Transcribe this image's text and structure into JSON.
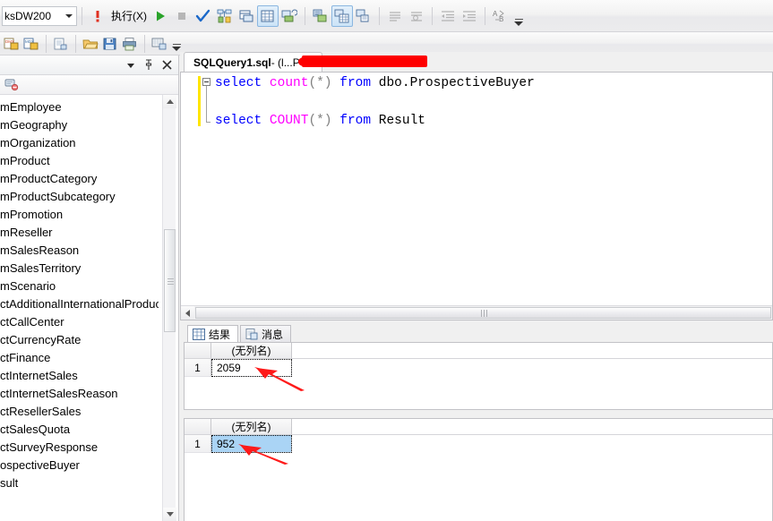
{
  "toolbar_main": {
    "database_combo": {
      "value": "ksDW200",
      "icon": "chevron-down-icon"
    },
    "execute_label": "执行(X)",
    "buttons": [
      {
        "name": "debug-run-button",
        "icon": "exclamation-icon"
      },
      {
        "name": "execute-button",
        "icon": "play-icon"
      },
      {
        "name": "stop-button",
        "icon": "stop-icon"
      },
      {
        "name": "parse-query-button",
        "icon": "check-icon"
      },
      {
        "name": "display-estimated-plan-button",
        "icon": "estimated-plan-icon"
      },
      {
        "name": "query-options-button",
        "icon": "query-options-icon"
      },
      {
        "name": "include-actual-plan-button",
        "icon": "actual-plan-icon"
      },
      {
        "name": "include-client-statistics-button",
        "icon": "client-statistics-icon"
      },
      {
        "name": "results-to-text-button",
        "icon": "results-to-text-icon"
      },
      {
        "name": "results-to-grid-button",
        "icon": "results-to-grid-icon"
      },
      {
        "name": "results-to-file-button",
        "icon": "results-to-file-icon"
      },
      {
        "name": "comment-button",
        "icon": "comment-lines-icon"
      },
      {
        "name": "uncomment-button",
        "icon": "uncomment-lines-icon"
      },
      {
        "name": "decrease-indent-button",
        "icon": "decrease-indent-icon"
      },
      {
        "name": "increase-indent-button",
        "icon": "increase-indent-icon"
      },
      {
        "name": "find-replace-button",
        "icon": "find-replace-icon"
      },
      {
        "name": "toolbar-overflow-button",
        "icon": "overflow-chevron-icon"
      }
    ]
  },
  "toolbar_second": {
    "buttons": [
      {
        "name": "new-dmx-query-button",
        "icon": "dmx-query-icon"
      },
      {
        "name": "new-mdx-query-button",
        "icon": "mdx-query-icon"
      },
      {
        "name": "new-xmla-query-button",
        "icon": "xmla-query-icon"
      },
      {
        "name": "open-file-button",
        "icon": "open-folder-icon"
      },
      {
        "name": "save-button",
        "icon": "save-disk-icon"
      },
      {
        "name": "print-button",
        "icon": "printer-icon"
      },
      {
        "name": "activity-monitor-button",
        "icon": "activity-monitor-icon"
      },
      {
        "name": "toolbar2-overflow-button",
        "icon": "overflow-chevron-icon"
      }
    ]
  },
  "object_explorer": {
    "header_buttons": [
      {
        "name": "window-position-dropdown",
        "icon": "chevron-down-icon"
      },
      {
        "name": "auto-hide-pin-button",
        "icon": "pin-icon"
      },
      {
        "name": "close-panel-button",
        "icon": "close-icon"
      }
    ],
    "toolbar_buttons": [
      {
        "name": "connect-object-explorer-button",
        "icon": "connect-plug-icon"
      }
    ],
    "tree_items": [
      "mEmployee",
      "mGeography",
      "mOrganization",
      "mProduct",
      "mProductCategory",
      "mProductSubcategory",
      "mPromotion",
      "mReseller",
      "mSalesReason",
      "mSalesTerritory",
      "mScenario",
      "ctAdditionalInternationalProduc",
      "ctCallCenter",
      "ctCurrencyRate",
      "ctFinance",
      "ctInternetSales",
      "ctInternetSalesReason",
      "ctResellerSales",
      "ctSalesQuota",
      "ctSurveyResponse",
      "ospectiveBuyer",
      "sult"
    ]
  },
  "editor": {
    "tab_title": "SQLQuery1.sql",
    "tab_subtitle": " - (l...PC\\",
    "lines": [
      {
        "tokens": [
          {
            "text": "select",
            "style": "kw"
          },
          {
            "text": " ",
            "style": "pl"
          },
          {
            "text": "count",
            "style": "fn"
          },
          {
            "text": "(*)",
            "style": "punct"
          },
          {
            "text": " ",
            "style": "pl"
          },
          {
            "text": "from",
            "style": "kw"
          },
          {
            "text": " dbo.ProspectiveBuyer",
            "style": "pl"
          }
        ]
      },
      {
        "tokens": []
      },
      {
        "tokens": [
          {
            "text": "select",
            "style": "kw"
          },
          {
            "text": " ",
            "style": "pl"
          },
          {
            "text": "COUNT",
            "style": "fn"
          },
          {
            "text": "(*)",
            "style": "punct"
          },
          {
            "text": " ",
            "style": "pl"
          },
          {
            "text": "from",
            "style": "kw"
          },
          {
            "text": " Result",
            "style": "pl"
          }
        ]
      }
    ]
  },
  "results": {
    "tabs": [
      {
        "label": "结果",
        "icon": "grid-icon",
        "selected": true
      },
      {
        "label": "消息",
        "icon": "messages-icon",
        "selected": false
      }
    ],
    "grids": [
      {
        "name": "result-grid-1",
        "columns": [
          "(无列名)"
        ],
        "rows": [
          {
            "num": "1",
            "cells": [
              "2059"
            ],
            "selected": false
          }
        ]
      },
      {
        "name": "result-grid-2",
        "columns": [
          "(无列名)"
        ],
        "rows": [
          {
            "num": "1",
            "cells": [
              "952"
            ],
            "selected": true
          }
        ]
      }
    ]
  },
  "annotations": [
    {
      "name": "red-arrow-annotation-1",
      "target": "2059"
    },
    {
      "name": "red-arrow-annotation-2",
      "target": "952"
    }
  ],
  "colors": {
    "keyword": "#0000ff",
    "function": "#ff00ff",
    "selection": "#aad4f5",
    "annotation": "#fe0000",
    "change_bar": "#ffe500"
  }
}
